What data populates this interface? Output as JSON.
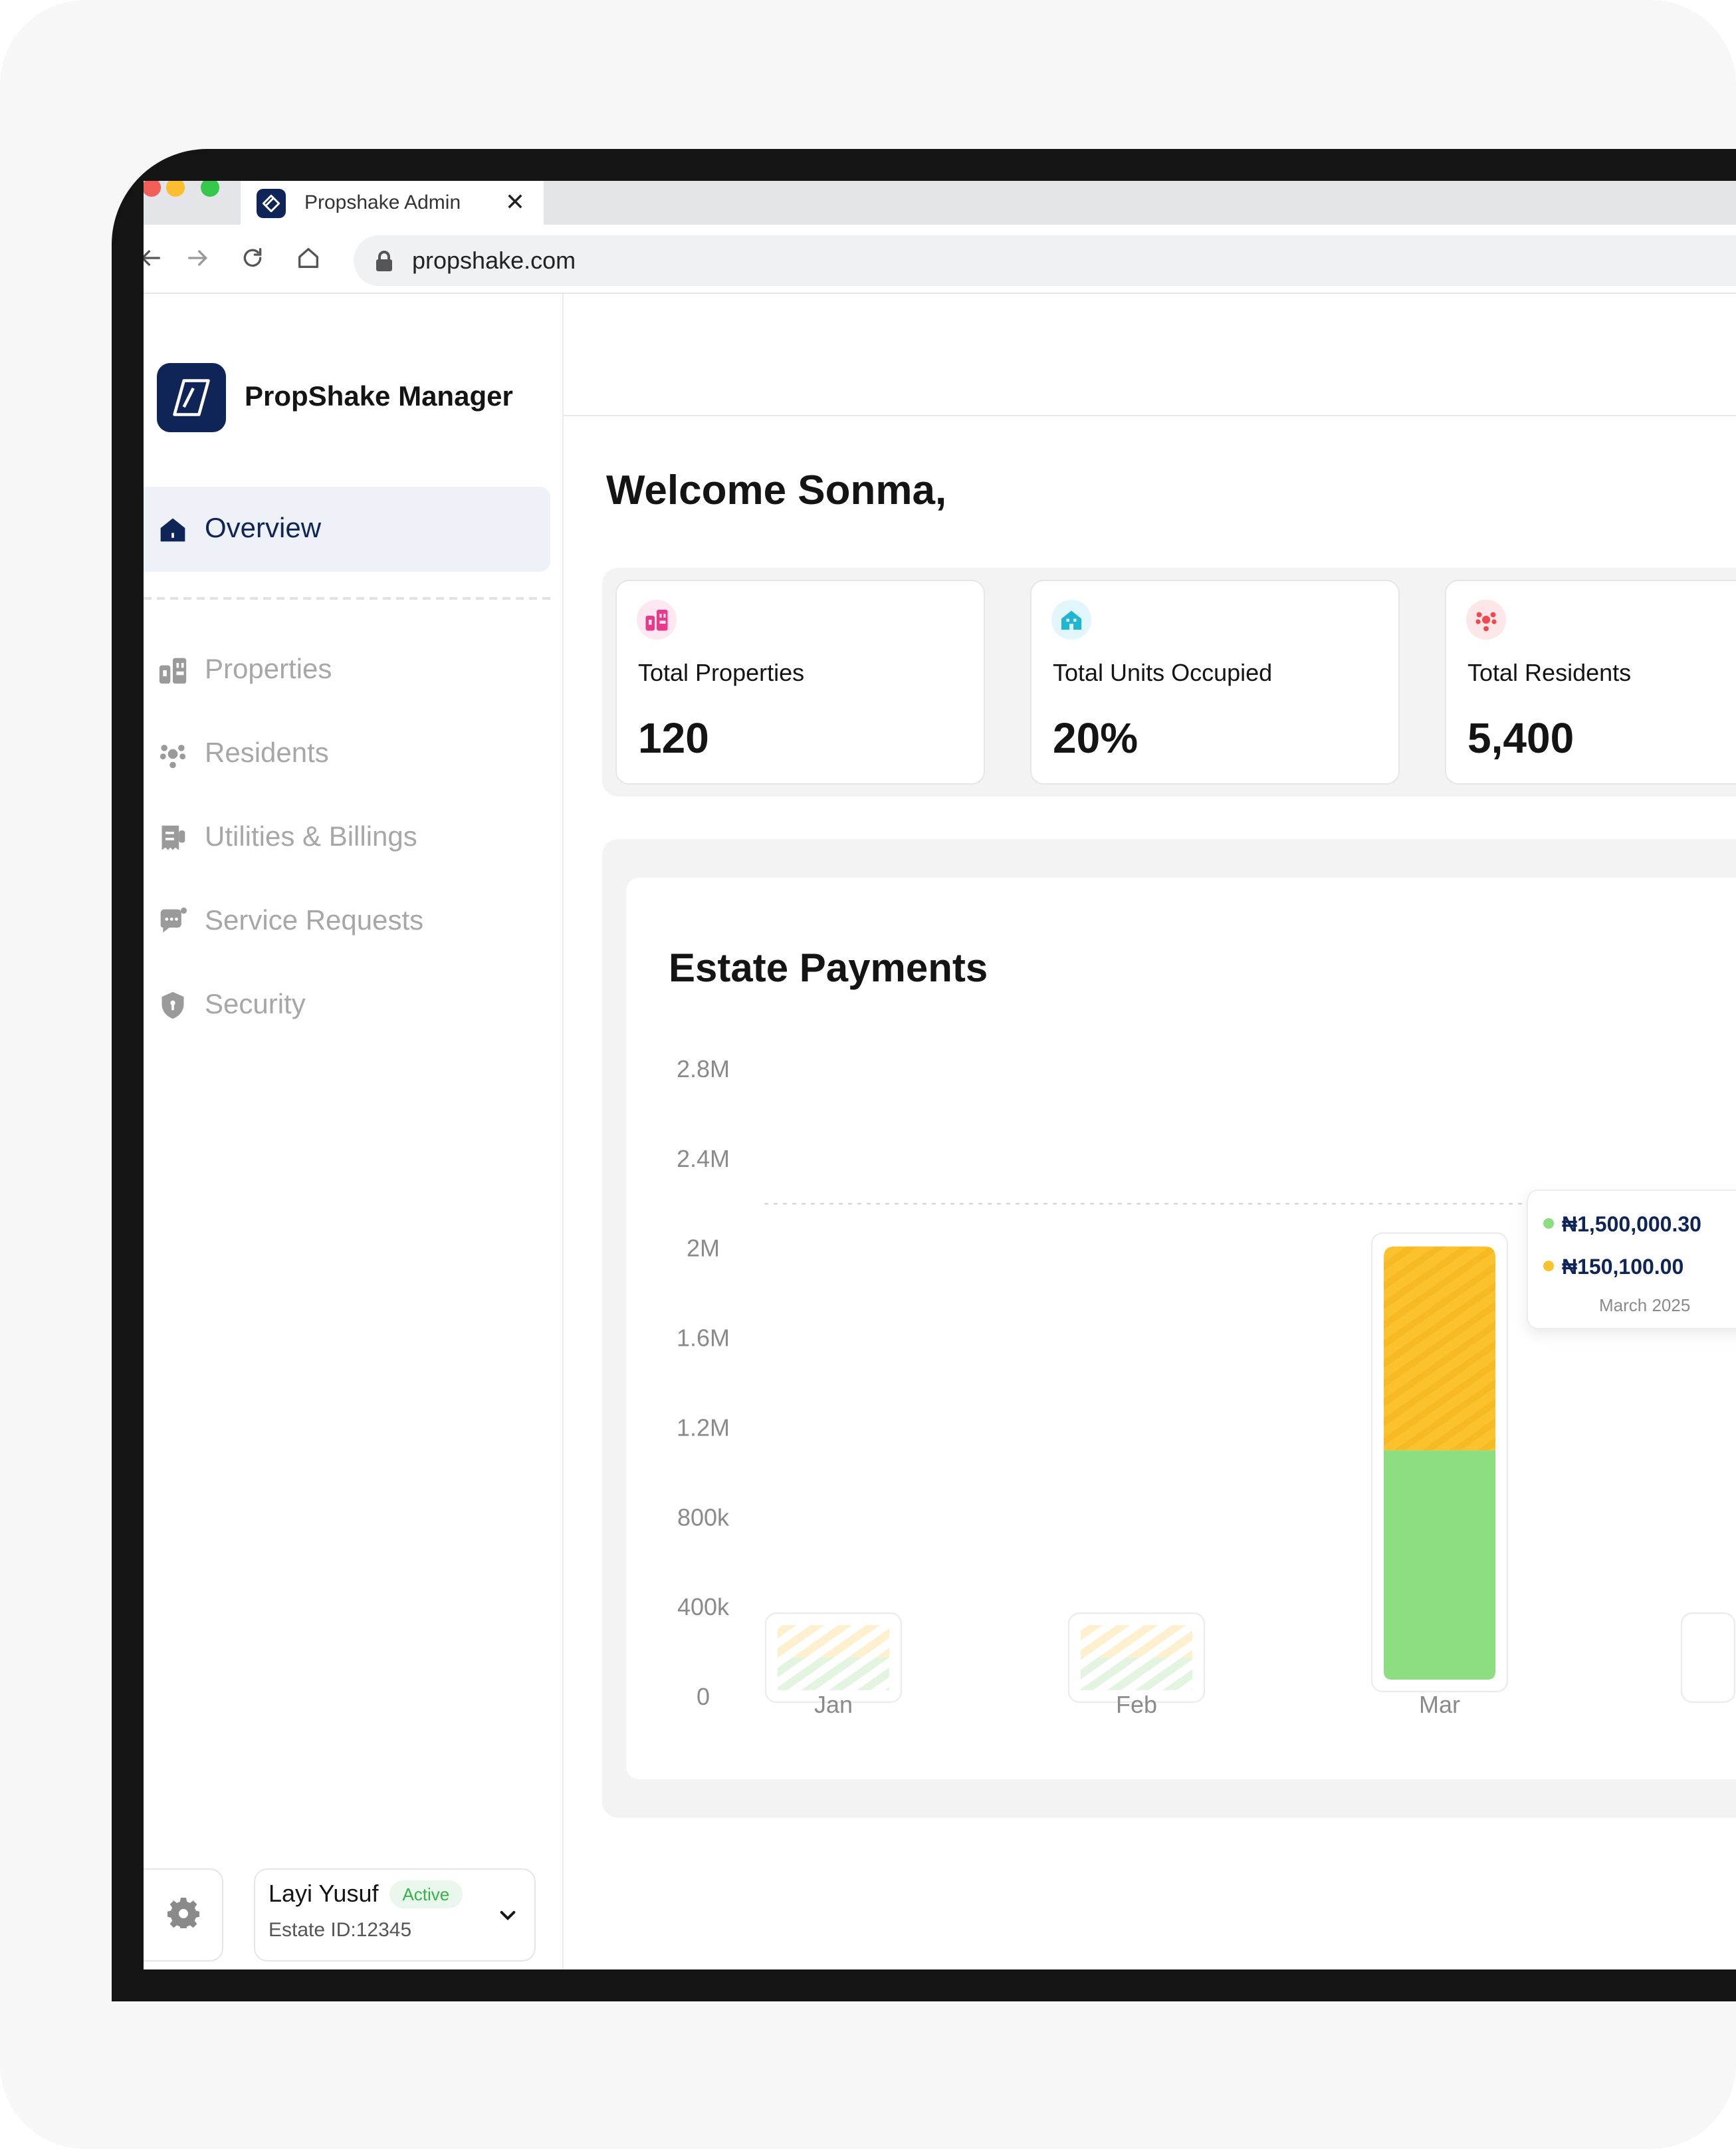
{
  "browser": {
    "tab_title": "Propshake Admin",
    "tab_close": "✕",
    "url": "propshake.com",
    "icons": [
      "back-icon",
      "forward-icon",
      "reload-icon",
      "home-icon",
      "lock-icon"
    ]
  },
  "sidebar": {
    "brand": "PropShake Manager",
    "active_item": {
      "label": "Overview",
      "icon": "home-icon"
    },
    "items": [
      {
        "label": "Properties",
        "icon": "buildings-icon"
      },
      {
        "label": "Residents",
        "icon": "people-icon"
      },
      {
        "label": "Utilities & Billings",
        "icon": "receipt-icon"
      },
      {
        "label": "Service Requests",
        "icon": "chat-icon"
      },
      {
        "label": "Security",
        "icon": "shield-icon"
      }
    ],
    "user": {
      "name": "Layi Yusuf",
      "status": "Active",
      "estate_id": "Estate ID:12345"
    }
  },
  "main": {
    "welcome": "Welcome Sonma,",
    "stats": [
      {
        "label": "Total Properties",
        "value": "120",
        "icon": "buildings-icon",
        "color": "#e8398a"
      },
      {
        "label": "Total Units Occupied",
        "value": "20%",
        "icon": "house-icon",
        "color": "#1fb6d6"
      },
      {
        "label": "Total Residents",
        "value": "5,400",
        "icon": "people-icon",
        "color": "#f0484e"
      }
    ]
  },
  "chart_data": {
    "type": "bar",
    "title": "Estate Payments",
    "categories": [
      "Jan",
      "Feb",
      "Mar"
    ],
    "series": [
      {
        "values": [
          null,
          null,
          1100000
        ],
        "color": "#8cde81"
      },
      {
        "values": [
          null,
          null,
          850000
        ],
        "color": "#fbc22e"
      }
    ],
    "placeholder_categories": [
      "Jan",
      "Feb"
    ],
    "ytick_labels": [
      "0",
      "400k",
      "800k",
      "1.2M",
      "1.6M",
      "2M",
      "2.4M",
      "2.8M"
    ],
    "ylim": [
      0,
      2800000
    ],
    "reference_line": 2200000,
    "tooltip": {
      "line1": "₦1,500,000.30",
      "line2": "₦150,100.00",
      "period": "March 2025"
    }
  },
  "colors": {
    "brand": "#0f2557",
    "green": "#8cde81",
    "yellow": "#fbc22e",
    "active_badge": "#36b24a"
  }
}
